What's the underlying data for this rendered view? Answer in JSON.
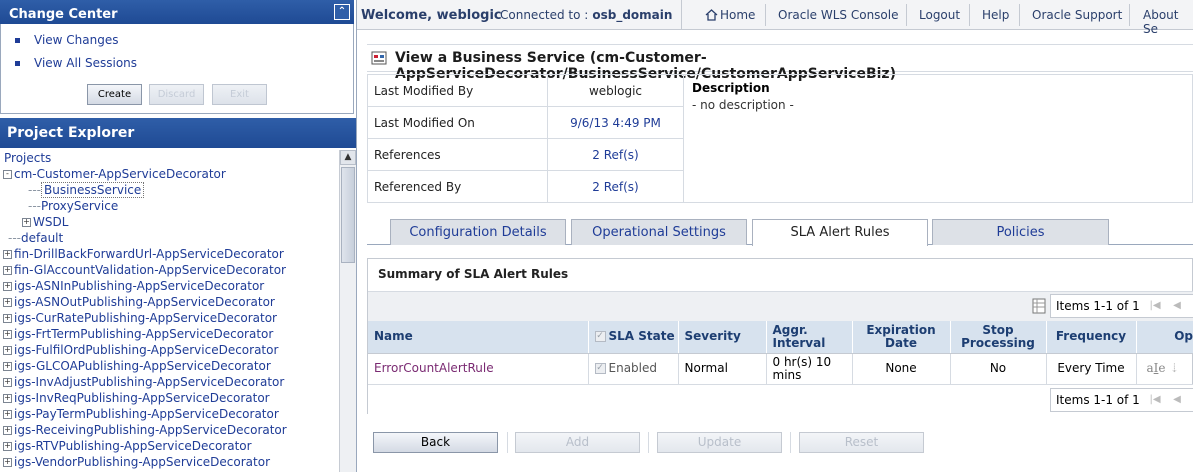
{
  "change_center": {
    "title": "Change Center",
    "links": [
      "View Changes",
      "View All Sessions"
    ],
    "buttons": [
      "Create",
      "Discard",
      "Exit"
    ]
  },
  "project_explorer": {
    "title": "Project Explorer",
    "tree": [
      {
        "label": "Projects",
        "level": 0,
        "expander": ""
      },
      {
        "label": "cm-Customer-AppServiceDecorator",
        "level": 0,
        "expander": "-"
      },
      {
        "label": "BusinessService",
        "level": 2,
        "expander": "",
        "selected": true
      },
      {
        "label": "ProxyService",
        "level": 2,
        "expander": ""
      },
      {
        "label": "WSDL",
        "level": 1,
        "expander": "+"
      },
      {
        "label": "default",
        "level": 0,
        "expander": ""
      },
      {
        "label": "fin-DrillBackForwardUrl-AppServiceDecorator",
        "level": 0,
        "expander": "+"
      },
      {
        "label": "fin-GlAccountValidation-AppServiceDecorator",
        "level": 0,
        "expander": "+"
      },
      {
        "label": "igs-ASNInPublishing-AppServiceDecorator",
        "level": 0,
        "expander": "+"
      },
      {
        "label": "igs-ASNOutPublishing-AppServiceDecorator",
        "level": 0,
        "expander": "+"
      },
      {
        "label": "igs-CurRatePublishing-AppServiceDecorator",
        "level": 0,
        "expander": "+"
      },
      {
        "label": "igs-FrtTermPublishing-AppServiceDecorator",
        "level": 0,
        "expander": "+"
      },
      {
        "label": "igs-FulfilOrdPublishing-AppServiceDecorator",
        "level": 0,
        "expander": "+"
      },
      {
        "label": "igs-GLCOAPublishing-AppServiceDecorator",
        "level": 0,
        "expander": "+"
      },
      {
        "label": "igs-InvAdjustPublishing-AppServiceDecorator",
        "level": 0,
        "expander": "+"
      },
      {
        "label": "igs-InvReqPublishing-AppServiceDecorator",
        "level": 0,
        "expander": "+"
      },
      {
        "label": "igs-PayTermPublishing-AppServiceDecorator",
        "level": 0,
        "expander": "+"
      },
      {
        "label": "igs-ReceivingPublishing-AppServiceDecorator",
        "level": 0,
        "expander": "+"
      },
      {
        "label": "igs-RTVPublishing-AppServiceDecorator",
        "level": 0,
        "expander": "+"
      },
      {
        "label": "igs-VendorPublishing-AppServiceDecorator",
        "level": 0,
        "expander": "+"
      }
    ]
  },
  "topbar": {
    "welcome": "Welcome, weblogic",
    "connected_label": "Connected to :",
    "domain": "osb_domain",
    "nav": [
      "Home",
      "Oracle WLS Console",
      "Logout",
      "Help",
      "Oracle Support",
      "About Se"
    ]
  },
  "page": {
    "title": "View a Business Service (cm-Customer-AppServiceDecorator/BusinessService/CustomerAppServiceBiz)",
    "info": [
      {
        "label": "Last Modified By",
        "value": "weblogic",
        "link": false
      },
      {
        "label": "Last Modified On",
        "value": "9/6/13 4:49 PM",
        "link": true
      },
      {
        "label": "References",
        "value": "2 Ref(s)",
        "link": true
      },
      {
        "label": "Referenced By",
        "value": "2 Ref(s)",
        "link": true
      }
    ],
    "description_label": "Description",
    "description_value": "- no description -",
    "tabs": [
      "Configuration Details",
      "Operational Settings",
      "SLA Alert Rules",
      "Policies"
    ],
    "active_tab": "SLA Alert Rules"
  },
  "summary": {
    "title": "Summary of SLA Alert Rules",
    "pager_text": "Items 1-1 of 1",
    "columns": [
      "Name",
      "SLA State",
      "Severity",
      "Aggr.\nInterval",
      "Expiration\nDate",
      "Stop\nProcessing",
      "Frequency",
      "Op"
    ],
    "rows": [
      {
        "name": "ErrorCountAlertRule",
        "sla_state": "Enabled",
        "severity": "Normal",
        "interval": "0 hr(s) 10 mins",
        "expiration": "None",
        "stop": "No",
        "frequency": "Every Time"
      }
    ]
  },
  "bottom_buttons": [
    "Back",
    "Add",
    "Update",
    "Reset"
  ]
}
